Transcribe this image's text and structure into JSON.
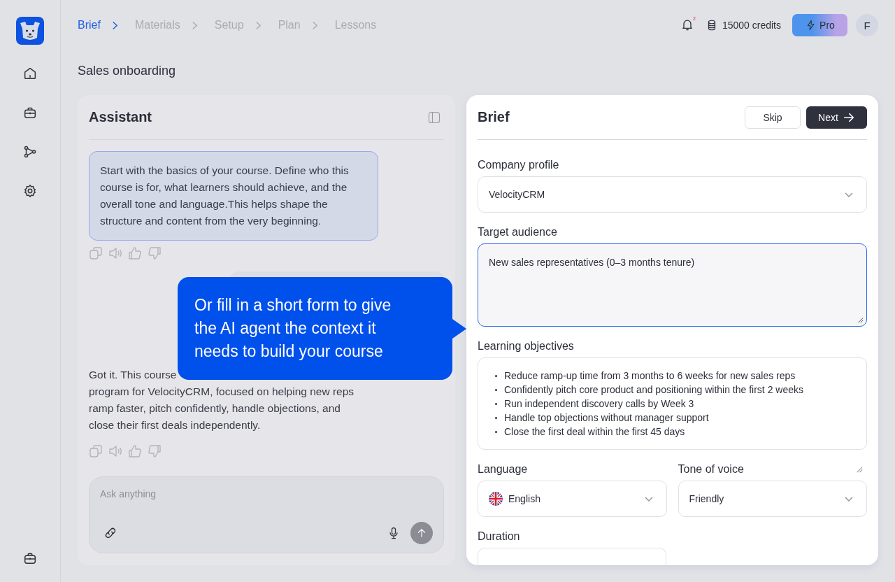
{
  "breadcrumbs": [
    {
      "label": "Brief",
      "selected": true
    },
    {
      "label": "Materials",
      "selected": false
    },
    {
      "label": "Setup",
      "selected": false
    },
    {
      "label": "Plan",
      "selected": false
    },
    {
      "label": "Lessons",
      "selected": false
    }
  ],
  "topbar": {
    "notification_count": "2",
    "credits": "15000 credits",
    "plan": "Pro",
    "avatar": "F"
  },
  "page_title": "Sales onboarding",
  "assistant": {
    "title": "Assistant",
    "messages": [
      {
        "kind": "bubble",
        "lines": [
          "Start with the basics of your course. Define who this",
          "course is for, what learners should achieve, and the",
          "overall tone and language.This helps shape the",
          "structure and content from the very beginning."
        ]
      },
      {
        "kind": "user"
      },
      {
        "kind": "plain",
        "lines": [
          "Got it. This course",
          "program for VelocityCRM, focused on helping new reps",
          "ramp faster, pitch confidently, handle objections, and",
          "close their first deals independently."
        ]
      }
    ],
    "input": {
      "placeholder": "Ask anything"
    }
  },
  "callout": {
    "lines": [
      "Or fill in a short form to give",
      "the AI agent the context it",
      "needs to build your course"
    ]
  },
  "brief": {
    "title": "Brief",
    "skip": "Skip",
    "next": "Next",
    "fields": [
      {
        "kind": "select",
        "label": "Company profile",
        "value": "VelocityCRM"
      },
      {
        "kind": "textarea",
        "label": "Target audience",
        "value": "New sales representatives (0–3 months tenure)",
        "focused": true
      },
      {
        "kind": "list",
        "label": "Learning objectives",
        "items": [
          "Reduce ramp-up time from 3 months to 6 weeks for new sales reps",
          "Confidently pitch core product and positioning within the first 2 weeks",
          "Run independent discovery calls by Week 3",
          "Handle top objections without manager support",
          "Close the first deal within the first 45 days"
        ]
      },
      {
        "kind": "row",
        "fields": [
          {
            "kind": "language",
            "label": "Language",
            "value": "English"
          },
          {
            "kind": "tone",
            "label": "Tone of voice",
            "value": "Friendly"
          }
        ]
      },
      {
        "kind": "cut",
        "label": "Duration"
      }
    ]
  }
}
